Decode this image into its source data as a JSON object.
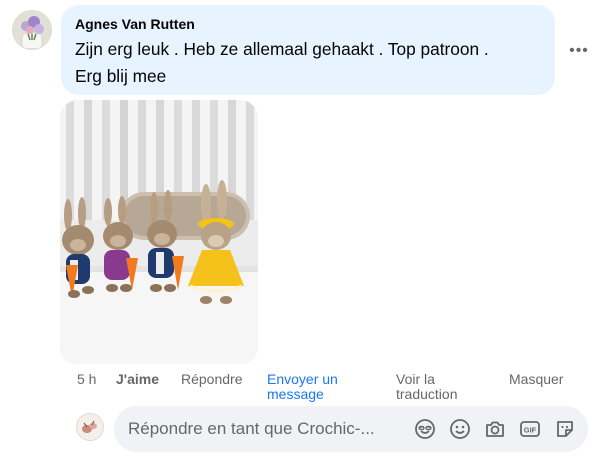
{
  "comment": {
    "author": "Agnes Van Rutten",
    "text_line1": "Zijn erg leuk . Heb ze allemaal gehaakt . Top patroon .",
    "text_line2": "Erg blij mee",
    "more_label": "•••",
    "photo_description_icon": "crochet-bunnies-photo"
  },
  "actions": {
    "time": "5 h",
    "like": "J'aime",
    "reply": "Répondre",
    "message_line1": "Envoyer un",
    "message_line2": "message",
    "translate_line1": "Voir la",
    "translate_line2": "traduction",
    "hide": "Masquer"
  },
  "reply_box": {
    "placeholder": "Répondre en tant que Crochic-...",
    "icons": [
      "avatar-sticker-icon",
      "emoji-icon",
      "camera-icon",
      "gif-icon",
      "sticker-icon"
    ]
  },
  "colors": {
    "bubble": "#e7f3ff",
    "link": "#1877f2",
    "secondary_text": "#65676b",
    "input_bg": "#f0f2f5"
  }
}
